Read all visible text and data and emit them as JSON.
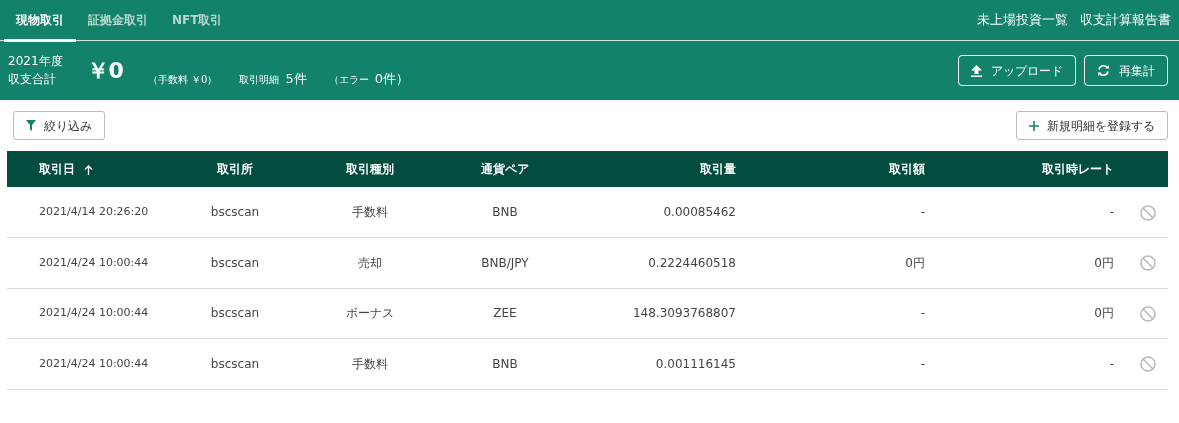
{
  "tabs": [
    {
      "label": "現物取引",
      "selected": true
    },
    {
      "label": "証拠金取引",
      "selected": false
    },
    {
      "label": "NFT取引",
      "selected": false
    }
  ],
  "top_links": [
    "未上場投資一覧",
    "収支計算報告書"
  ],
  "summary": {
    "year": "2021年度",
    "label": "収支合計",
    "total": "￥0",
    "fee": "（手数料 ￥0）",
    "details_label": "取引明細",
    "details_count": "5件",
    "error_label": "（エラー",
    "error_count": "0件）"
  },
  "summary_buttons": [
    {
      "label": "アップロード",
      "kind": "upload"
    },
    {
      "label": "再集計",
      "kind": "refresh"
    }
  ],
  "filter_button": "絞り込み",
  "add_button": "新規明細を登録する",
  "table": {
    "columns": [
      {
        "label": "取引日",
        "sorted": true
      },
      {
        "label": "取引所",
        "sorted": false
      },
      {
        "label": "取引種別",
        "sorted": false
      },
      {
        "label": "通貨ペア",
        "sorted": false
      },
      {
        "label": "取引量",
        "sorted": false
      },
      {
        "label": "取引額",
        "sorted": false
      },
      {
        "label": "取引時レート",
        "sorted": false
      }
    ],
    "rows": [
      [
        "2021/4/14 20:26:20",
        "bscscan",
        "手数料",
        "BNB",
        "0.00085462",
        "-",
        "-"
      ],
      [
        "2021/4/24 10:00:44",
        "bscscan",
        "売却",
        "BNB/JPY",
        "0.2224460518",
        "0円",
        "0円"
      ],
      [
        "2021/4/24 10:00:44",
        "bscscan",
        "ボーナス",
        "ZEE",
        "148.3093768807",
        "-",
        "0円"
      ],
      [
        "2021/4/24 10:00:44",
        "bscscan",
        "手数料",
        "BNB",
        "0.001116145",
        "-",
        "-"
      ]
    ]
  }
}
